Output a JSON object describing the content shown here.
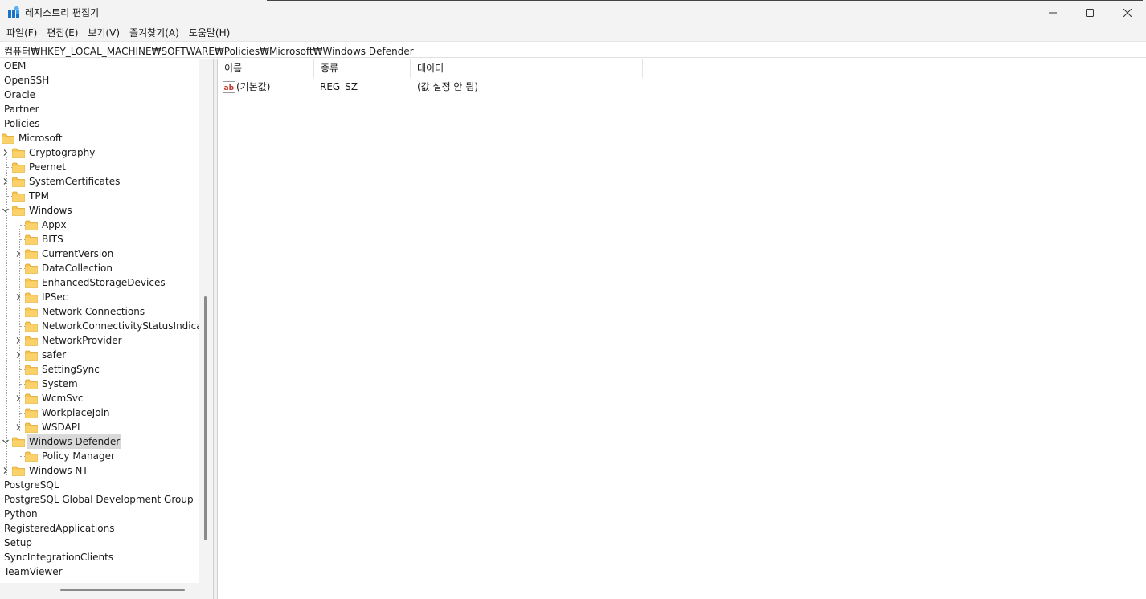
{
  "window": {
    "title": "레지스트리 편집기",
    "colors": {
      "titlebar": "#f3f3f3",
      "selection": "#d9d9d9",
      "folder": "#f8c44f"
    }
  },
  "menu": {
    "items": [
      "파일(F)",
      "편집(E)",
      "보기(V)",
      "즐겨찾기(A)",
      "도움말(H)"
    ]
  },
  "address": {
    "path": "컴퓨터₩HKEY_LOCAL_MACHINE₩SOFTWARE₩Policies₩Microsoft₩Windows Defender"
  },
  "tree": {
    "items": [
      {
        "label": "OEM",
        "level": 0
      },
      {
        "label": "OpenSSH",
        "level": 0
      },
      {
        "label": "Oracle",
        "level": 0
      },
      {
        "label": "Partner",
        "level": 0
      },
      {
        "label": "Policies",
        "level": 0
      },
      {
        "label": "Microsoft",
        "level": 0,
        "folder": true
      },
      {
        "label": "Cryptography",
        "level": 1,
        "folder": true,
        "expander": "collapsed"
      },
      {
        "label": "Peernet",
        "level": 1,
        "folder": true
      },
      {
        "label": "SystemCertificates",
        "level": 1,
        "folder": true,
        "expander": "collapsed"
      },
      {
        "label": "TPM",
        "level": 1,
        "folder": true
      },
      {
        "label": "Windows",
        "level": 1,
        "folder": true,
        "expander": "expanded"
      },
      {
        "label": "Appx",
        "level": 2,
        "folder": true
      },
      {
        "label": "BITS",
        "level": 2,
        "folder": true
      },
      {
        "label": "CurrentVersion",
        "level": 2,
        "folder": true,
        "expander": "collapsed"
      },
      {
        "label": "DataCollection",
        "level": 2,
        "folder": true
      },
      {
        "label": "EnhancedStorageDevices",
        "level": 2,
        "folder": true
      },
      {
        "label": "IPSec",
        "level": 2,
        "folder": true,
        "expander": "collapsed"
      },
      {
        "label": "Network Connections",
        "level": 2,
        "folder": true
      },
      {
        "label": "NetworkConnectivityStatusIndicator",
        "level": 2,
        "folder": true
      },
      {
        "label": "NetworkProvider",
        "level": 2,
        "folder": true,
        "expander": "collapsed"
      },
      {
        "label": "safer",
        "level": 2,
        "folder": true,
        "expander": "collapsed"
      },
      {
        "label": "SettingSync",
        "level": 2,
        "folder": true
      },
      {
        "label": "System",
        "level": 2,
        "folder": true
      },
      {
        "label": "WcmSvc",
        "level": 2,
        "folder": true,
        "expander": "collapsed"
      },
      {
        "label": "WorkplaceJoin",
        "level": 2,
        "folder": true
      },
      {
        "label": "WSDAPI",
        "level": 2,
        "folder": true,
        "expander": "collapsed"
      },
      {
        "label": "Windows Defender",
        "level": 1,
        "folder": true,
        "expander": "expanded",
        "selected": true
      },
      {
        "label": "Policy Manager",
        "level": 2,
        "folder": true
      },
      {
        "label": "Windows NT",
        "level": 1,
        "folder": true,
        "expander": "collapsed"
      },
      {
        "label": "PostgreSQL",
        "level": 0
      },
      {
        "label": "PostgreSQL Global Development Group",
        "level": 0
      },
      {
        "label": "Python",
        "level": 0
      },
      {
        "label": "RegisteredApplications",
        "level": 0
      },
      {
        "label": "Setup",
        "level": 0
      },
      {
        "label": "SyncIntegrationClients",
        "level": 0
      },
      {
        "label": "TeamViewer",
        "level": 0
      }
    ]
  },
  "list": {
    "columns": [
      "이름",
      "종류",
      "데이터"
    ],
    "rows": [
      {
        "icon": "string-value-icon",
        "name": "(기본값)",
        "type": "REG_SZ",
        "data": "(값 설정 안 됨)"
      }
    ]
  }
}
